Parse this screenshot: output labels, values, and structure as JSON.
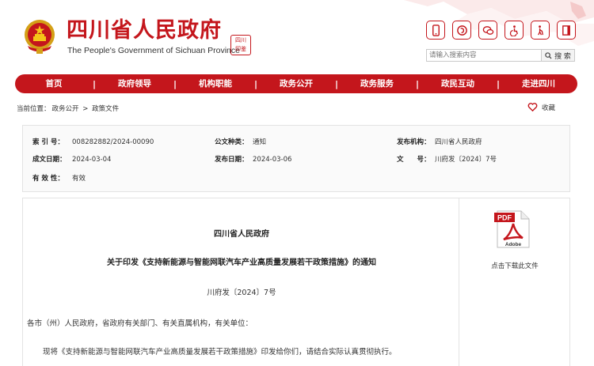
{
  "header": {
    "title": "四川省人民政府",
    "subtitle": "The People's Government of Sichuan Province",
    "seal_text": [
      "四川",
      "印鉴"
    ],
    "search_placeholder": "请输入搜索内容",
    "search_button": "搜 索",
    "icons": [
      "mobile-icon",
      "weibo-icon",
      "wechat-icon",
      "accessibility-icon",
      "elderly-icon",
      "exit-icon"
    ]
  },
  "nav": {
    "items": [
      "首页",
      "政府领导",
      "机构职能",
      "政务公开",
      "政务服务",
      "政民互动",
      "走进四川"
    ],
    "separator": "|"
  },
  "breadcrumb": {
    "prefix": "当前位置：",
    "items": [
      "政务公开",
      "政策文件"
    ],
    "separator": ">"
  },
  "favorite": {
    "label": "收藏"
  },
  "meta": {
    "index_label": "索 引 号：",
    "index_value": "008282882/2024-00090",
    "category_label": "公文种类：",
    "category_value": "通知",
    "publisher_label": "发布机构：",
    "publisher_value": "四川省人民政府",
    "created_label": "成文日期：",
    "created_value": "2024-03-04",
    "published_label": "发布日期：",
    "published_value": "2024-03-06",
    "docno_label": "文　　号：",
    "docno_value": "川府发〔2024〕7号",
    "validity_label": "有 效 性：",
    "validity_value": "有效"
  },
  "document": {
    "issuer": "四川省人民政府",
    "title": "关于印发《支持新能源与智能网联汽车产业高质量发展若干政策措施》的通知",
    "number": "川府发〔2024〕7号",
    "salutation": "各市（州）人民政府，省政府有关部门、有关直属机构，有关单位：",
    "body": "现将《支持新能源与智能网联汽车产业高质量发展若干政策措施》印发给你们，请结合实际认真贯彻执行。"
  },
  "download": {
    "pdf_text": "PDF",
    "adobe_text": "Adobe",
    "label": "点击下载此文件"
  },
  "colors": {
    "brand_red": "#c4161c",
    "meta_bg": "#fafafa"
  }
}
